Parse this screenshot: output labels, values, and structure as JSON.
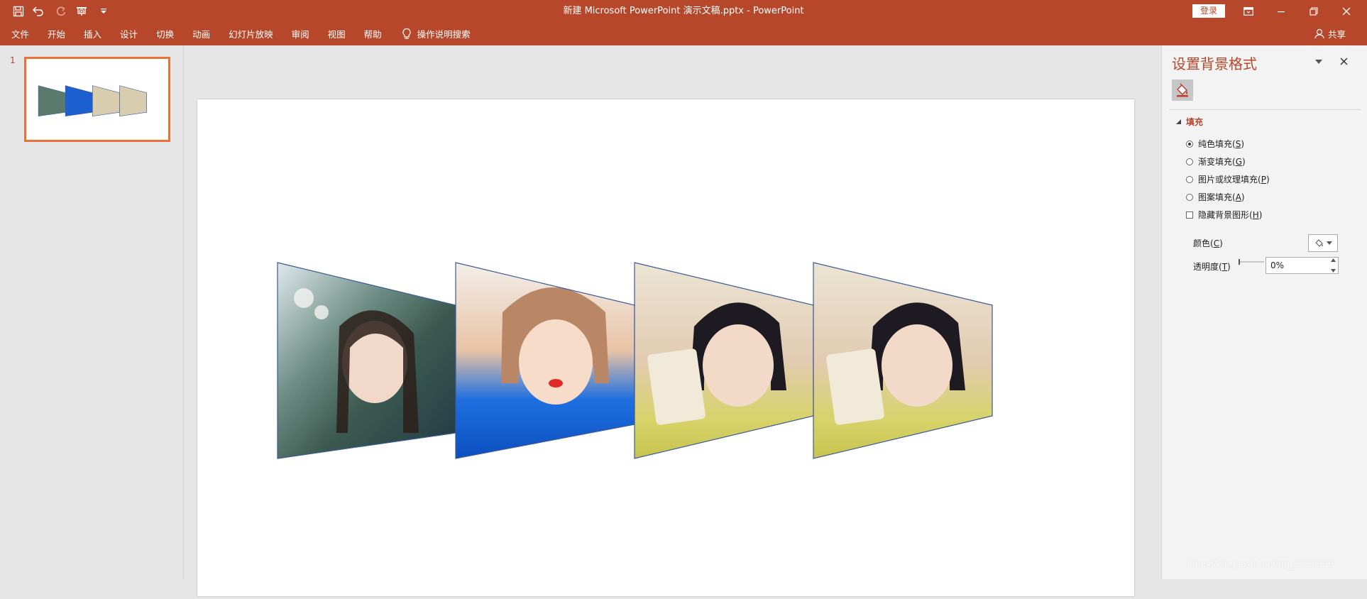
{
  "window": {
    "title": "新建 Microsoft PowerPoint 演示文稿.pptx  -  PowerPoint",
    "login_label": "登录"
  },
  "ribbon": {
    "tabs": [
      "文件",
      "开始",
      "插入",
      "设计",
      "切换",
      "动画",
      "幻灯片放映",
      "审阅",
      "视图",
      "帮助"
    ],
    "tell_me": "操作说明搜索",
    "share": "共享"
  },
  "thumbnails": {
    "slide_number": "1"
  },
  "format_pane": {
    "title": "设置背景格式",
    "section": "填充",
    "options": [
      {
        "label": "纯色填充(",
        "key": "S",
        "type": "radio",
        "checked": true
      },
      {
        "label": "渐变填充(",
        "key": "G",
        "type": "radio",
        "checked": false
      },
      {
        "label": "图片或纹理填充(",
        "key": "P",
        "type": "radio",
        "checked": false
      },
      {
        "label": "图案填充(",
        "key": "A",
        "type": "radio",
        "checked": false
      },
      {
        "label": "隐藏背景图形(",
        "key": "H",
        "type": "checkbox",
        "checked": false
      }
    ],
    "color_label": "颜色(",
    "color_key": "C",
    "transparency_label": "透明度(",
    "transparency_key": "T",
    "transparency_value": "0%"
  },
  "colors": {
    "accent": "#b7472a",
    "thumb_border": "#e8733a",
    "panel_bg": "#f3f3f3",
    "workspace_bg": "#e6e6e6"
  },
  "watermark": "https://blog.csdn.net/qq_3528366"
}
